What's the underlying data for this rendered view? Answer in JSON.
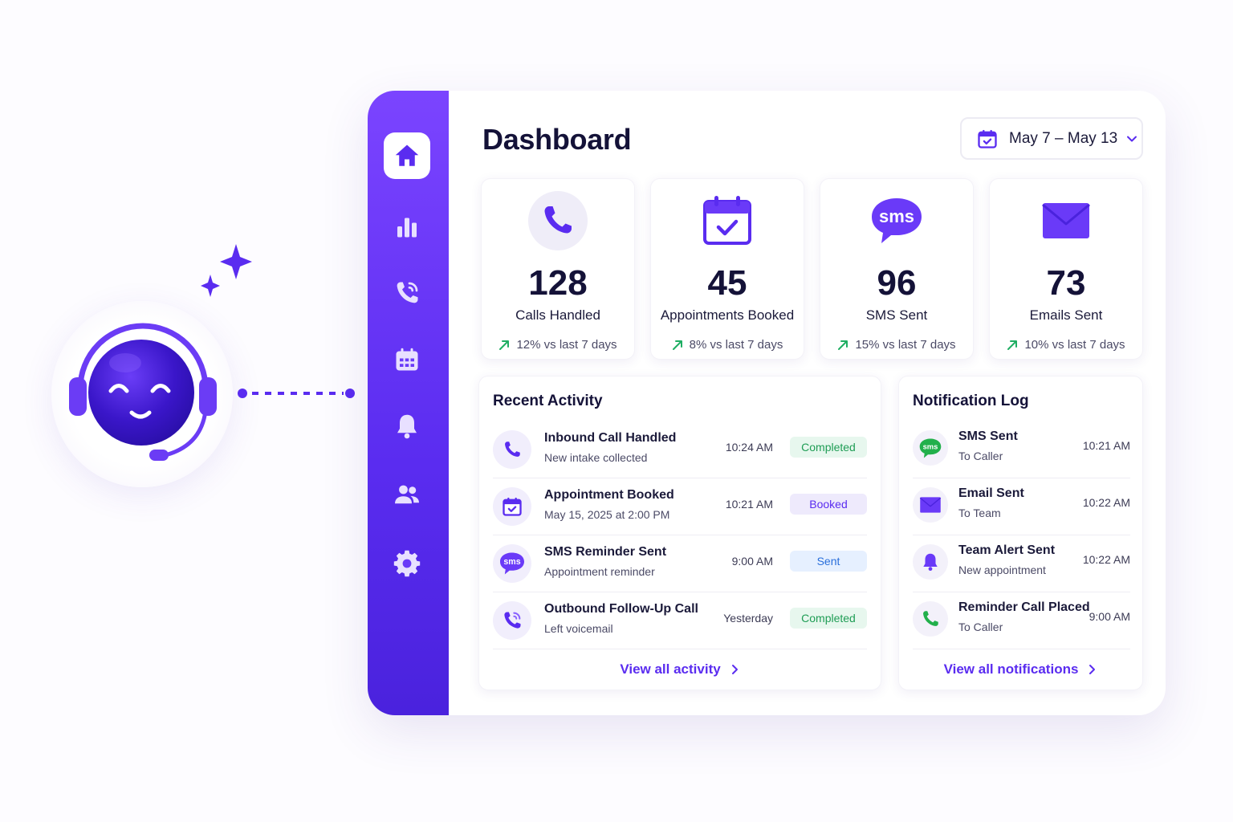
{
  "colors": {
    "accent": "#5a2cf0",
    "sidebar_top": "#7b44ff",
    "success": "#1f9d55",
    "trend_up": "#1fae63",
    "sms_green": "#22b04b"
  },
  "mascot": {
    "icon": "headset-smiley-icon"
  },
  "sidebar": {
    "items": [
      {
        "icon": "home-icon",
        "active": true
      },
      {
        "icon": "bar-chart-icon",
        "active": false
      },
      {
        "icon": "phone-call-icon",
        "active": false
      },
      {
        "icon": "calendar-icon",
        "active": false
      },
      {
        "icon": "bell-icon",
        "active": false
      },
      {
        "icon": "users-icon",
        "active": false
      },
      {
        "icon": "gear-icon",
        "active": false
      }
    ]
  },
  "header": {
    "title": "Dashboard",
    "date_range": "May 7 – May 13"
  },
  "stats": [
    {
      "value": "128",
      "label": "Calls Handled",
      "trend": "12% vs last 7 days",
      "icon": "phone-icon"
    },
    {
      "value": "45",
      "label": "Appointments Booked",
      "trend": "8% vs last 7 days",
      "icon": "calendar-check-icon"
    },
    {
      "value": "96",
      "label": "SMS Sent",
      "trend": "15% vs last 7 days",
      "icon": "sms-bubble-icon",
      "icon_text": "sms"
    },
    {
      "value": "73",
      "label": "Emails Sent",
      "trend": "10% vs last 7 days",
      "icon": "envelope-icon"
    }
  ],
  "recent_activity": {
    "title": "Recent Activity",
    "items": [
      {
        "title": "Inbound Call Handled",
        "subtitle": "New intake collected",
        "time": "10:24 AM",
        "status": "Completed",
        "status_color": "green",
        "icon": "phone-icon"
      },
      {
        "title": "Appointment Booked",
        "subtitle": "May 15, 2025 at 2:00 PM",
        "time": "10:21 AM",
        "status": "Booked",
        "status_color": "purple",
        "icon": "calendar-check-icon"
      },
      {
        "title": "SMS Reminder Sent",
        "subtitle": "Appointment reminder",
        "time": "9:00 AM",
        "status": "Sent",
        "status_color": "blue",
        "icon": "sms-bubble-icon",
        "icon_text": "sms"
      },
      {
        "title": "Outbound Follow-Up Call",
        "subtitle": "Left voicemail",
        "time": "Yesterday",
        "status": "Completed",
        "status_color": "green",
        "icon": "phone-outgoing-icon"
      }
    ],
    "view_all": "View all activity"
  },
  "notification_log": {
    "title": "Notification Log",
    "items": [
      {
        "title": "SMS Sent",
        "subtitle": "To Caller",
        "time": "10:21 AM",
        "icon": "sms-bubble-icon",
        "icon_text": "sms"
      },
      {
        "title": "Email Sent",
        "subtitle": "To Team",
        "time": "10:22 AM",
        "icon": "envelope-icon"
      },
      {
        "title": "Team Alert Sent",
        "subtitle": "New appointment",
        "time": "10:22 AM",
        "icon": "bell-icon"
      },
      {
        "title": "Reminder Call Placed",
        "subtitle": "To Caller",
        "time": "9:00 AM",
        "icon": "phone-icon"
      }
    ],
    "view_all": "View all notifications"
  }
}
